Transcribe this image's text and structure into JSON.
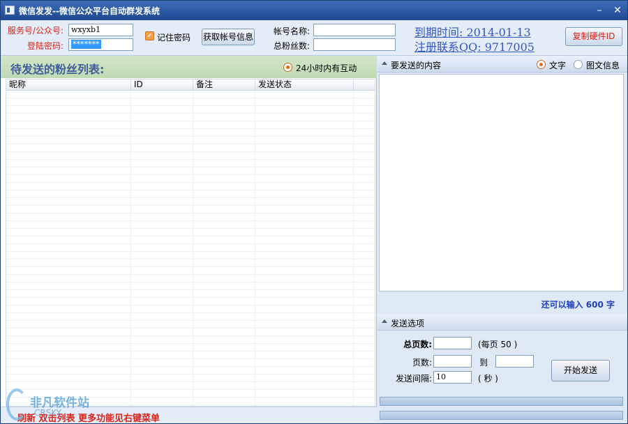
{
  "window": {
    "title": "微信发发--微信公众平台自动群发系统",
    "minimize_glyph": "–",
    "close_glyph": "✕"
  },
  "login": {
    "account_label": "服务号/公众号:",
    "account_value": "wxyxb1",
    "password_label": "登陆密码:",
    "password_value": "*******",
    "remember_label": "记住密码",
    "remember_checked": true,
    "fetch_button": "获取帐号信息"
  },
  "account_info": {
    "name_label": "帐号名称:",
    "name_value": "",
    "fans_label": "总粉丝数:",
    "fans_value": ""
  },
  "license": {
    "expire_text": "到期时间: 2014-01-13",
    "contact_text": "注册联系QQ: 9717005 ",
    "copy_hw_button": "复制硬件ID"
  },
  "fan_list": {
    "heading": "待发送的粉丝列表:",
    "filter_label": "24小时内有互动",
    "filter_selected": true,
    "columns": [
      "昵称",
      "ID",
      "备注",
      "发送状态"
    ],
    "rows": []
  },
  "status_bar": {
    "hint": "刷新 双击列表 更多功能见右键菜单"
  },
  "content": {
    "section_title": "要发送的内容",
    "type_text": "文字",
    "type_rich": "图文信息",
    "selected_type": "文字",
    "remaining_text": "还可以输入 600 字"
  },
  "send_options": {
    "section_title": "发送选项",
    "total_pages_label": "总页数:",
    "total_pages_value": "",
    "per_page_text": "(每页 50 )",
    "pages_label": "页数:",
    "pages_from": "",
    "to_label": "到",
    "pages_to": "",
    "interval_label": "发送间隔:",
    "interval_value": "10",
    "interval_unit": "( 秒 )",
    "start_button": "开始发送"
  },
  "watermark": {
    "text": "非凡软件站",
    "sub": "CRSKY"
  },
  "colors": {
    "titlebar": "#2a58a0",
    "accent_red": "#d8241a",
    "link_blue": "#3358c4",
    "list_header_green": "#c9e0bf"
  }
}
